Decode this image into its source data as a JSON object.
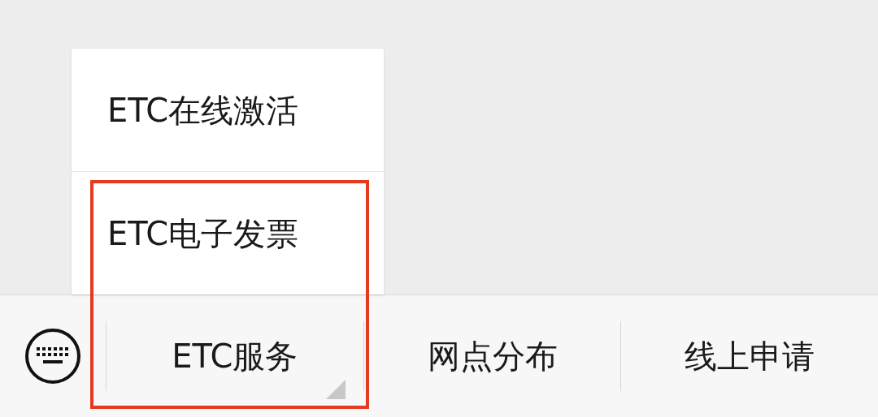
{
  "popup_menu": {
    "items": [
      {
        "label": "ETC在线激活"
      },
      {
        "label": "ETC电子发票"
      }
    ]
  },
  "bottom_bar": {
    "keyboard_toggle": true,
    "items": [
      {
        "label": "ETC服务",
        "has_submenu": true
      },
      {
        "label": "网点分布",
        "has_submenu": false
      },
      {
        "label": "线上申请",
        "has_submenu": false
      }
    ]
  },
  "highlight_frame": true
}
